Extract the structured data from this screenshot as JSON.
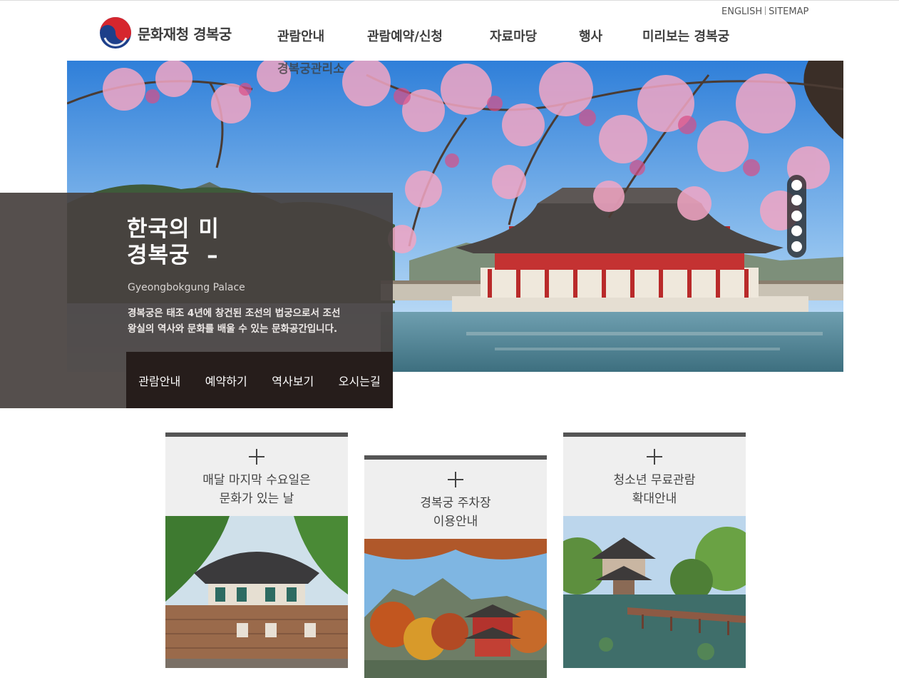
{
  "header": {
    "utility_links": [
      "ENGLISH",
      "SITEMAP"
    ],
    "logo_text": "문화재청 경복궁",
    "nav": [
      "관람안내",
      "관람예약/신청",
      "자료마당",
      "행사",
      "미리보는 경복궁"
    ],
    "nav_submenu_overlap": "경복궁관리소"
  },
  "hero": {
    "title": "한국의 미\n경복궁  –",
    "subtitle": "Gyeongbokgung Palace",
    "description": "경복궁은 태조 4년에 창건된 조선의 법궁으로서 조선\n왕실의 역사와 문화를 배울 수 있는 문화공간입니다.",
    "quick_links": [
      "관람안내",
      "예약하기",
      "역사보기",
      "오시는길"
    ],
    "slide_count": 5,
    "active_slide": 1
  },
  "cards": [
    {
      "label": "매달 마지막 수요일은\n문화가 있는 날"
    },
    {
      "label": "경복궁 주차장\n이용안내"
    },
    {
      "label": "청소년 무료관람\n확대안내"
    }
  ],
  "colors": {
    "panel": "#484240",
    "quick_bar": "#261d1b",
    "card_bar": "#555555",
    "card_head": "#efefef"
  }
}
